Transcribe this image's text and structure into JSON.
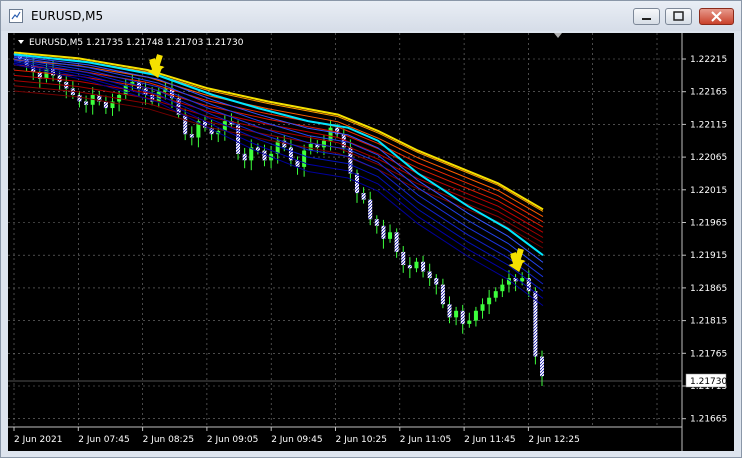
{
  "window": {
    "title": "EURUSD,M5"
  },
  "chart": {
    "info_label": "EURUSD,M5  1.21735 1.21748 1.21703 1.21730",
    "current_price": "1.21730",
    "price_ticks": [
      "1.22215",
      "1.22165",
      "1.22115",
      "1.22065",
      "1.22015",
      "1.21965",
      "1.21915",
      "1.21865",
      "1.21815",
      "1.21765",
      "1.21715",
      "1.21665"
    ],
    "time_ticks": [
      "2 Jun 2021",
      "2 Jun 07:45",
      "2 Jun 08:25",
      "2 Jun 09:05",
      "2 Jun 09:45",
      "2 Jun 10:25",
      "2 Jun 11:05",
      "2 Jun 11:45",
      "2 Jun 12:25"
    ],
    "colors": {
      "background": "#000000",
      "grid": "#7a7a7a",
      "bull": "#3cff3c",
      "bear": "#ffffff",
      "arrow": "#f5e000",
      "ribbon_top": "#f5e000",
      "ribbon_mid": "#00e6ff"
    }
  }
}
